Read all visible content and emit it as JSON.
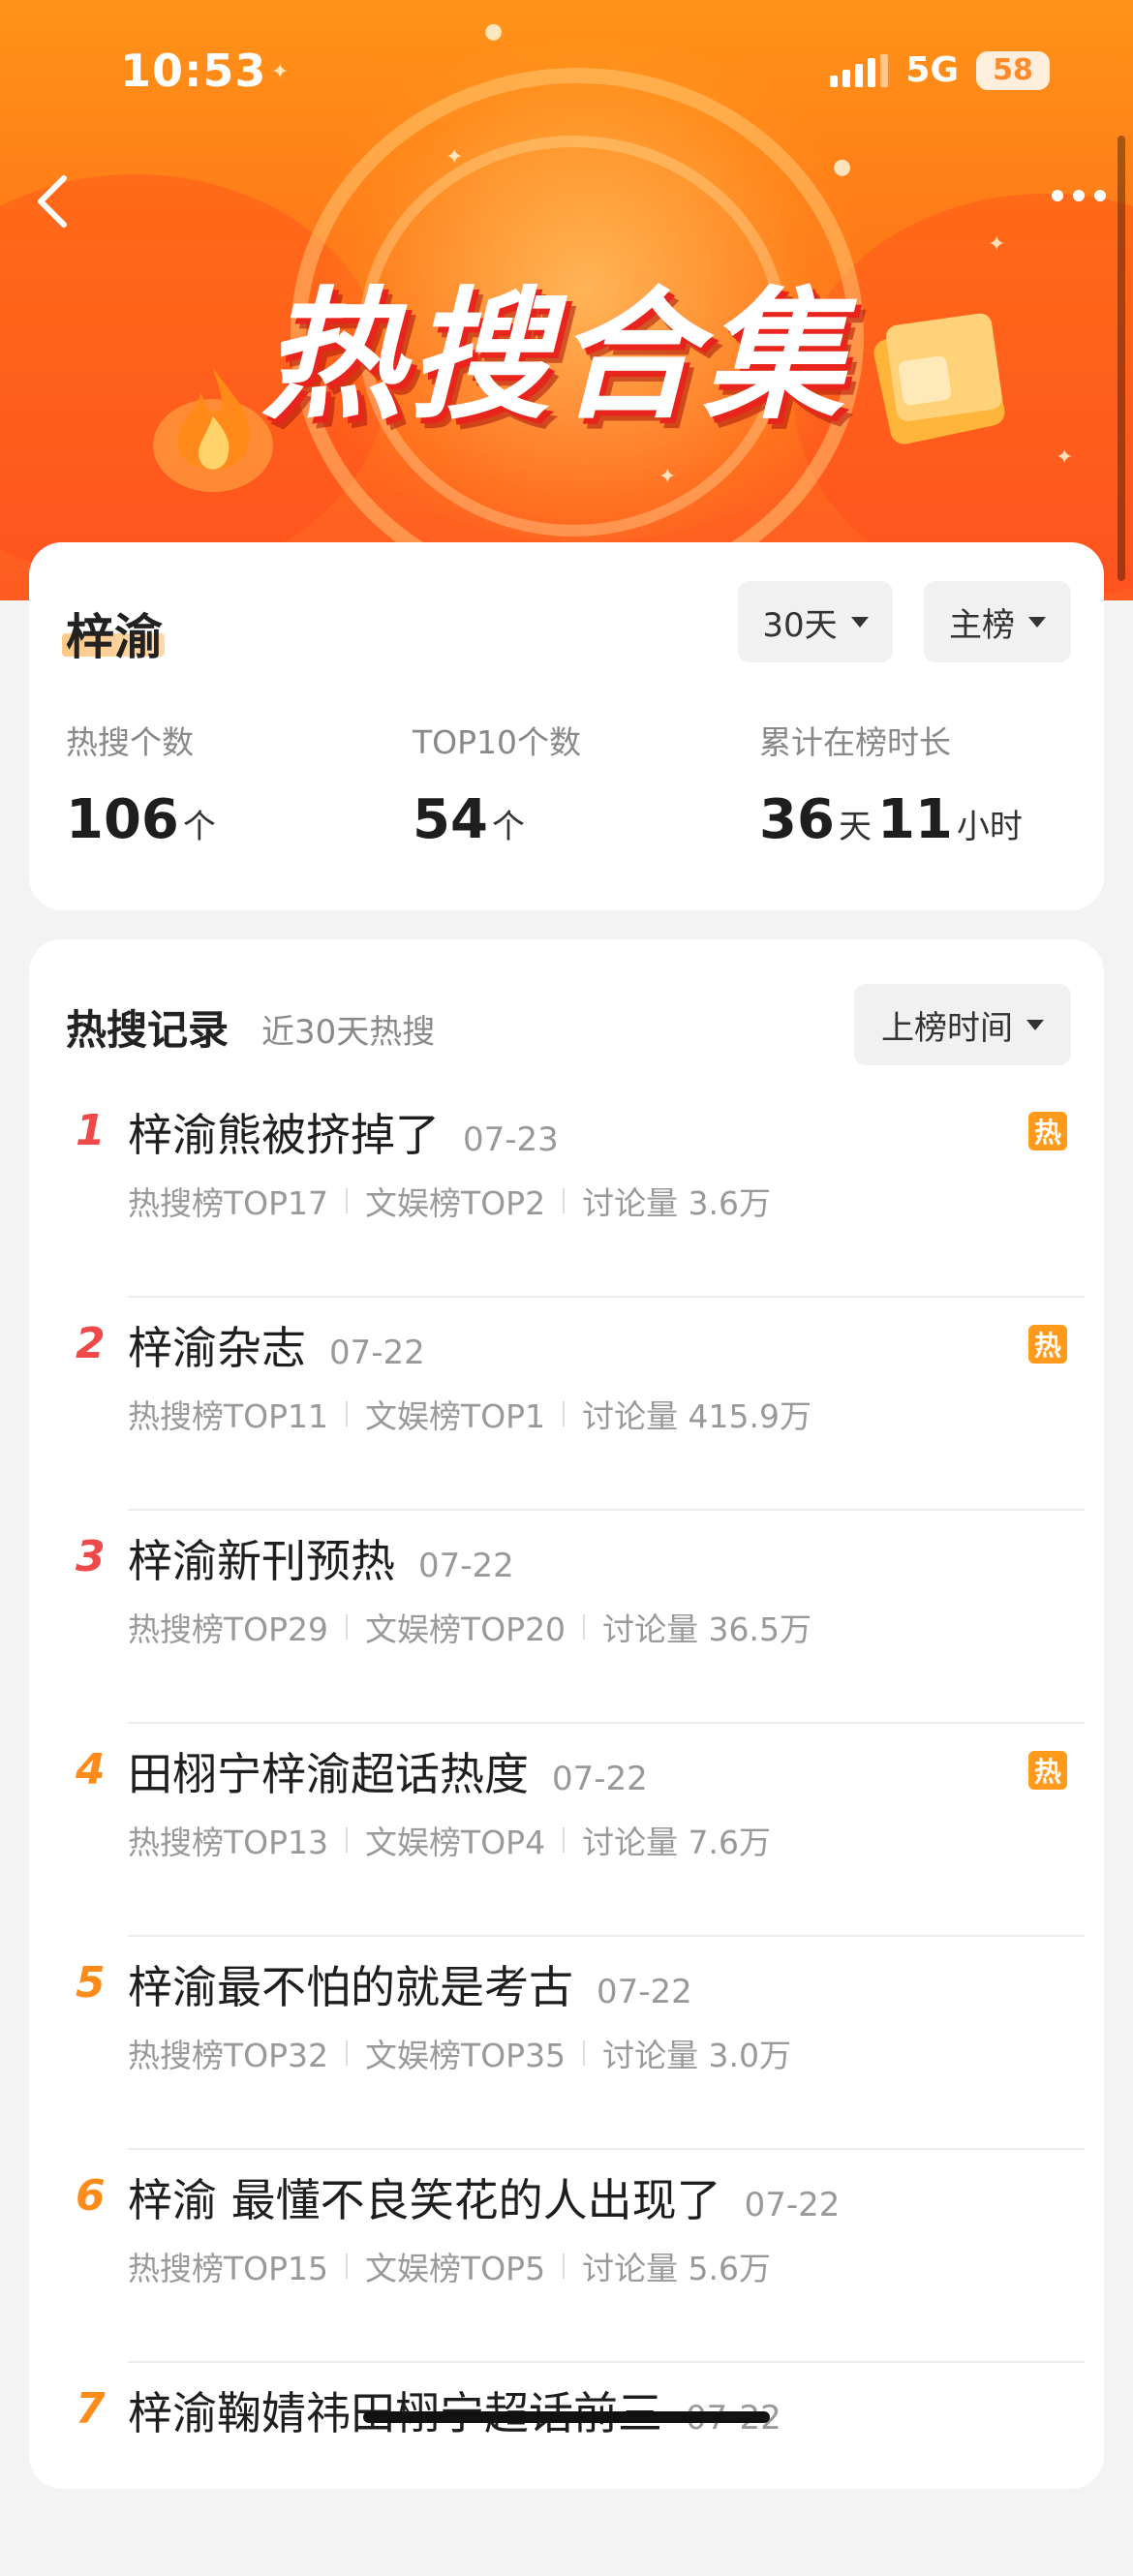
{
  "status_bar": {
    "time": "10:53",
    "network": "5G",
    "battery": "58"
  },
  "header": {
    "banner_title": "热搜合集"
  },
  "summary": {
    "name": "梓渝",
    "filter_period": "30天",
    "filter_board": "主榜",
    "stats": [
      {
        "label": "热搜个数",
        "value": "106",
        "unit": "个"
      },
      {
        "label": "TOP10个数",
        "value": "54",
        "unit": "个"
      },
      {
        "label": "累计在榜时长",
        "days": "36",
        "days_unit": "天",
        "hours": "11",
        "hours_unit": "小时"
      }
    ]
  },
  "records": {
    "title": "热搜记录",
    "subtitle": "近30天热搜",
    "sort_label": "上榜时间",
    "hot_badge": "热",
    "colors": {
      "rank_top3": "#ef4a4a",
      "rank_other": "#ff8b1a",
      "hot_badge": "#ff9a1c"
    },
    "items": [
      {
        "rank": "1",
        "title": "梓渝熊被挤掉了",
        "date": "07-23",
        "hot_board": "热搜榜TOP17",
        "ent_board": "文娱榜TOP2",
        "discussion": "讨论量 3.6万",
        "hot": true
      },
      {
        "rank": "2",
        "title": "梓渝杂志",
        "date": "07-22",
        "hot_board": "热搜榜TOP11",
        "ent_board": "文娱榜TOP1",
        "discussion": "讨论量 415.9万",
        "hot": true
      },
      {
        "rank": "3",
        "title": "梓渝新刊预热",
        "date": "07-22",
        "hot_board": "热搜榜TOP29",
        "ent_board": "文娱榜TOP20",
        "discussion": "讨论量 36.5万",
        "hot": false
      },
      {
        "rank": "4",
        "title": "田栩宁梓渝超话热度",
        "date": "07-22",
        "hot_board": "热搜榜TOP13",
        "ent_board": "文娱榜TOP4",
        "discussion": "讨论量 7.6万",
        "hot": true
      },
      {
        "rank": "5",
        "title": "梓渝最不怕的就是考古",
        "date": "07-22",
        "hot_board": "热搜榜TOP32",
        "ent_board": "文娱榜TOP35",
        "discussion": "讨论量 3.0万",
        "hot": false
      },
      {
        "rank": "6",
        "title": "梓渝 最懂不良笑花的人出现了",
        "date": "07-22",
        "hot_board": "热搜榜TOP15",
        "ent_board": "文娱榜TOP5",
        "discussion": "讨论量 5.6万",
        "hot": false
      },
      {
        "rank": "7",
        "title": "梓渝鞠婧祎田栩宁超话前三",
        "date": "07-22",
        "hot_board": "",
        "ent_board": "",
        "discussion": "",
        "hot": false
      }
    ]
  }
}
